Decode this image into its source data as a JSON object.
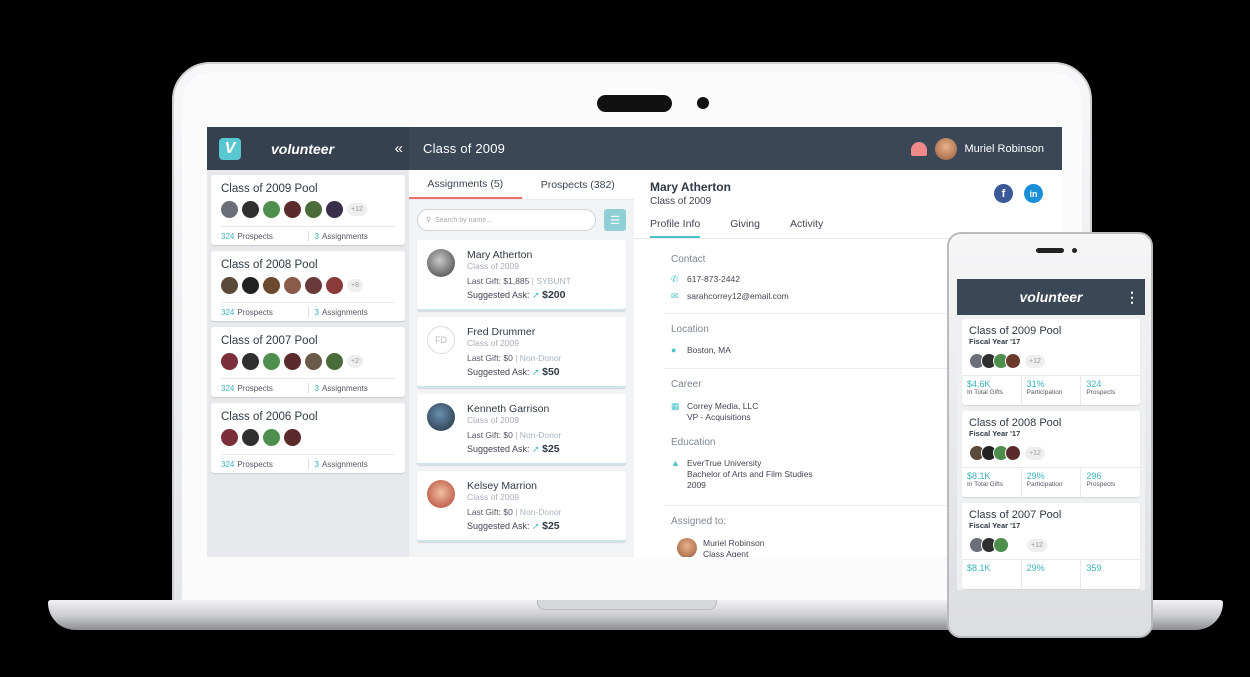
{
  "app": {
    "brand": "volunteer",
    "logo_letter": "V",
    "collapse": "«",
    "title": "Class of 2009",
    "user_name": "Muriel Robinson"
  },
  "pools": [
    {
      "title": "Class of 2009 Pool",
      "more": "+12",
      "prospects_n": "324",
      "prospects_l": "Prospects",
      "assign_n": "3",
      "assign_l": "Assignments"
    },
    {
      "title": "Class of 2008 Pool",
      "more": "+8",
      "prospects_n": "324",
      "prospects_l": "Prospects",
      "assign_n": "3",
      "assign_l": "Assignments"
    },
    {
      "title": "Class of 2007 Pool",
      "more": "+2",
      "prospects_n": "324",
      "prospects_l": "Prospects",
      "assign_n": "3",
      "assign_l": "Assignments"
    },
    {
      "title": "Class of 2006 Pool",
      "more": "",
      "prospects_n": "324",
      "prospects_l": "Prospects",
      "assign_n": "3",
      "assign_l": "Assignments"
    }
  ],
  "list": {
    "tab_assignments": "Assignments (5)",
    "tab_prospects": "Prospects (382)",
    "search_placeholder": "Search by name...",
    "cards": [
      {
        "name": "Mary Atherton",
        "class": "Class of 2009",
        "gift_label": "Last Gift:",
        "gift": "$1,885",
        "status": "| SYBUNT",
        "ask_label": "Suggested Ask:",
        "ask": "$200",
        "initials": ""
      },
      {
        "name": "Fred Drummer",
        "class": "Class of 2009",
        "gift_label": "Last Gift:",
        "gift": "$0",
        "status": "| Non-Donor",
        "ask_label": "Suggested Ask:",
        "ask": "$50",
        "initials": "FD"
      },
      {
        "name": "Kenneth Garrison",
        "class": "Class of 2009",
        "gift_label": "Last Gift:",
        "gift": "$0",
        "status": "| Non-Donor",
        "ask_label": "Suggested Ask:",
        "ask": "$25",
        "initials": ""
      },
      {
        "name": "Kelsey Marrion",
        "class": "Class of 2009",
        "gift_label": "Last Gift:",
        "gift": "$0",
        "status": "| Non-Donor",
        "ask_label": "Suggested Ask:",
        "ask": "$25",
        "initials": ""
      }
    ]
  },
  "profile": {
    "name": "Mary Atherton",
    "class": "Class of 2009",
    "tabs": [
      "Profile Info",
      "Giving",
      "Activity"
    ],
    "contact_h": "Contact",
    "phone": "617-873-2442",
    "email": "sarahcorrey12@email.com",
    "location_h": "Location",
    "location": "Boston, MA",
    "career_h": "Career",
    "company": "Correy Media, LLC",
    "role": "VP - Acquisitions",
    "education_h": "Education",
    "school": "EverTrue University",
    "degree": "Bachelor of Arts and Film Studies",
    "year": "2009",
    "assigned_h": "Assigned to:",
    "assignee": "Muriel Robinson",
    "assignee_role": "Class Agent"
  },
  "mobile": {
    "brand": "volunteer",
    "cards": [
      {
        "title": "Class of 2009 Pool",
        "sub": "Fiscal Year '17",
        "more": "+12",
        "s1v": "$4.6K",
        "s1l": "In Total Gifts",
        "s2v": "31%",
        "s2l": "Participation",
        "s3v": "324",
        "s3l": "Prospects"
      },
      {
        "title": "Class of 2008 Pool",
        "sub": "Fiscal Year '17",
        "more": "+12",
        "s1v": "$8.1K",
        "s1l": "In Total Gifts",
        "s2v": "29%",
        "s2l": "Participation",
        "s3v": "296",
        "s3l": "Prospects"
      },
      {
        "title": "Class of 2007 Pool",
        "sub": "Fiscal Year '17",
        "more": "+12",
        "s1v": "$8.1K",
        "s1l": "",
        "s2v": "29%",
        "s2l": "",
        "s3v": "359",
        "s3l": ""
      }
    ]
  },
  "colors": {
    "accent": "#4bc3c9",
    "topbar": "#3a4756",
    "tab_underline": "#ef6f6f"
  }
}
